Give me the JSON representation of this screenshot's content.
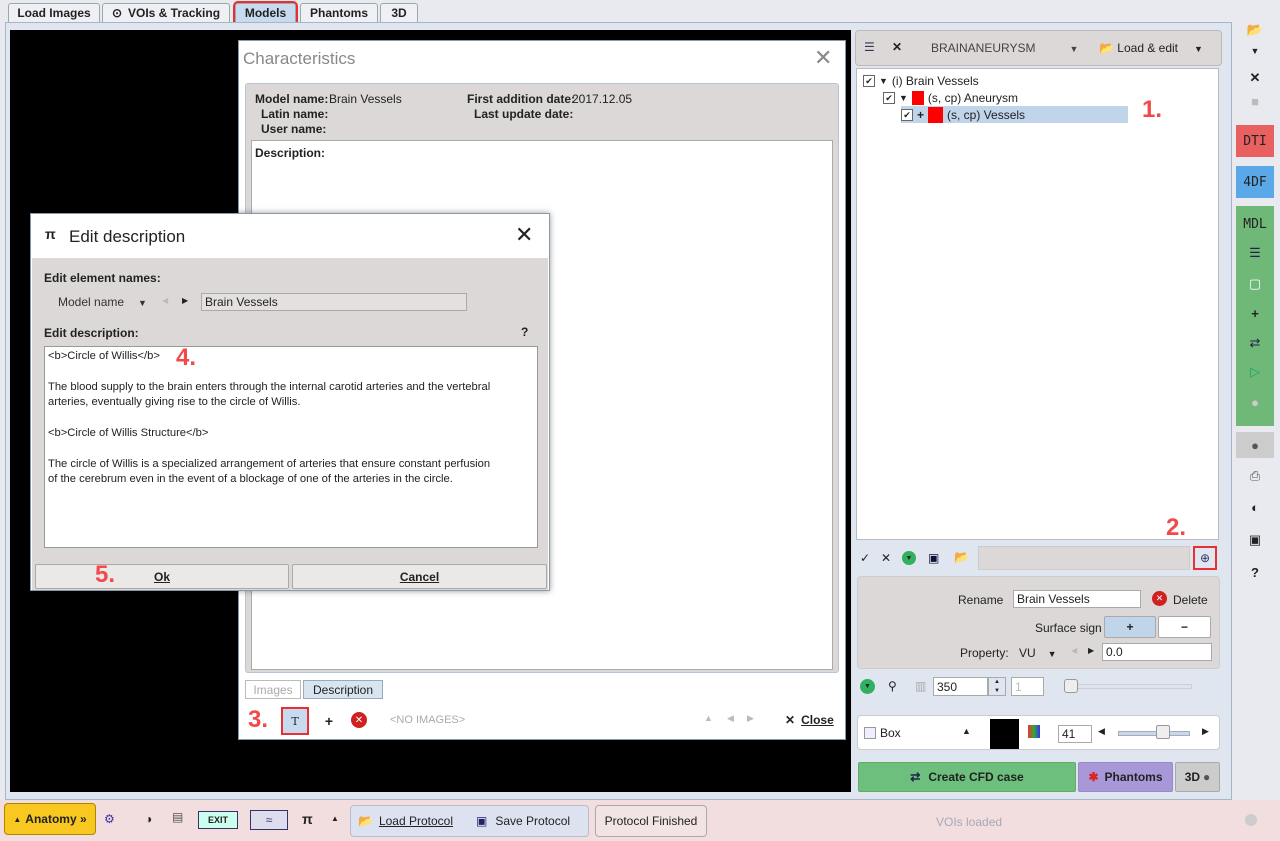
{
  "tabs": [
    "Load Images",
    "VOIs & Tracking",
    "Models",
    "Phantoms",
    "3D"
  ],
  "active_tab": "Models",
  "characteristics": {
    "title": "Characteristics",
    "model_name_label": "Model name:",
    "model_name": "Brain Vessels",
    "latin_name_label": "Latin name:",
    "user_name_label": "User name:",
    "first_addition_label": "First addition date:",
    "first_addition": "2017.12.05",
    "last_update_label": "Last update date:",
    "description_label": "Description:",
    "tabs": [
      "Images",
      "Description"
    ],
    "no_images": "<NO IMAGES>",
    "close": "Close"
  },
  "edit_dialog": {
    "title": "Edit description",
    "names_label": "Edit element names:",
    "name_selector": "Model name",
    "name_value": "Brain Vessels",
    "desc_label": "Edit description:",
    "help": "?",
    "lines": [
      "<b>Circle of Willis</b>",
      "",
      "The blood supply to the brain enters through the internal carotid arteries and the vertebral",
      "arteries, eventually giving rise to the circle of Willis.",
      "",
      "<b>Circle of Willis Structure</b>",
      "",
      "The circle of Willis is a specialized arrangement of arteries that ensure constant perfusion",
      "of the cerebrum even in the event of a blockage of one of the arteries in the circle."
    ],
    "ok": "Ok",
    "cancel": "Cancel"
  },
  "right_panel": {
    "database": "BRAINANEURYSM",
    "load_edit": "Load & edit",
    "tree": [
      "(i) Brain Vessels",
      "(s, cp) Aneurysm",
      "(s, cp) Vessels"
    ],
    "rename_label": "Rename",
    "rename_value": "Brain Vessels",
    "delete": "Delete",
    "surface_sign_label": "Surface sign",
    "plus": "+",
    "minus": "−",
    "property_label": "Property:",
    "property_select": "VU",
    "property_value": "0.0",
    "spin_value": "350",
    "frame_value": "1",
    "box_label": "Box",
    "level_value": "41",
    "create_cfd": "Create CFD case",
    "phantoms": "Phantoms",
    "three_d": "3D"
  },
  "sidebar": {
    "dti": "DTI",
    "fourdf": "4DF",
    "mdl": "MDL",
    "help": "?"
  },
  "bottom": {
    "anatomy": "Anatomy »",
    "load_protocol": "Load Protocol",
    "save_protocol": "Save Protocol",
    "protocol_finished": "Protocol Finished",
    "status": "VOIs loaded"
  },
  "annotations": [
    "1.",
    "2.",
    "3.",
    "4.",
    "5."
  ],
  "colors": {
    "annotation": "#f04a4a",
    "cfd": "#6cbf7c",
    "phantoms": "#a898d8",
    "dti": "#e86060",
    "fourdf": "#5aa8e8",
    "mdl": "#70b878",
    "anatomy": "#f8c820"
  }
}
